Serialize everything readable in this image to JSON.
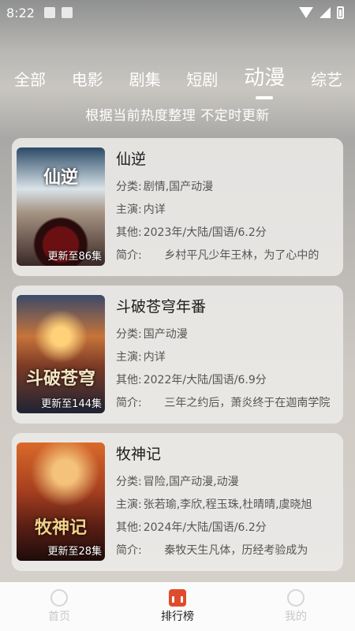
{
  "status_bar": {
    "time": "8:22"
  },
  "tabs": [
    {
      "label": "全部",
      "active": false
    },
    {
      "label": "电影",
      "active": false
    },
    {
      "label": "剧集",
      "active": false
    },
    {
      "label": "短剧",
      "active": false
    },
    {
      "label": "动漫",
      "active": true
    },
    {
      "label": "综艺",
      "active": false
    }
  ],
  "subtitle": "根据当前热度整理 不定时更新",
  "labels": {
    "category": "分类:",
    "cast": "主演:",
    "other": "其他:",
    "intro": "简介:"
  },
  "items": [
    {
      "poster_text": "仙逆",
      "episode_badge": "更新至86集",
      "title": "仙逆",
      "category": "剧情,国产动漫",
      "cast": "内详",
      "other": "2023年/大陆/国语/6.2分",
      "intro": "      乡村平凡少年王林，为了心中的"
    },
    {
      "poster_text": "斗破苍穹",
      "episode_badge": "更新至144集",
      "title": "斗破苍穹年番",
      "category": "国产动漫",
      "cast": "内详",
      "other": "2022年/大陆/国语/6.9分",
      "intro": "      三年之约后，萧炎终于在迦南学院"
    },
    {
      "poster_text": "牧神记",
      "episode_badge": "更新至28集",
      "title": "牧神记",
      "category": "冒险,国产动漫,动漫",
      "cast": "张若瑜,李欣,程玉珠,杜晴晴,虞晓旭",
      "other": "2024年/大陆/国语/6.2分",
      "intro": "      秦牧天生凡体，历经考验成为"
    }
  ],
  "bottom_nav": [
    {
      "label": "首页",
      "active": false
    },
    {
      "label": "排行榜",
      "active": true
    },
    {
      "label": "我的",
      "active": false
    }
  ]
}
